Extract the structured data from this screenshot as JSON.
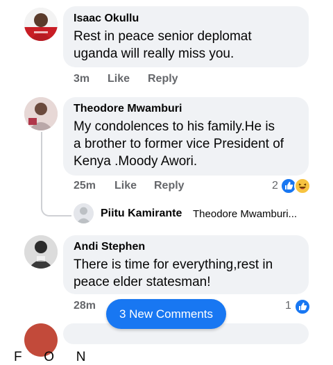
{
  "comments": [
    {
      "author": "Isaac Okullu",
      "text_lines": [
        "Rest in peace senior deplomat",
        "uganda will really miss you."
      ],
      "time": "3m",
      "like_label": "Like",
      "reply_label": "Reply"
    },
    {
      "author": "Theodore Mwamburi",
      "text_lines": [
        "My condolences to his family.He is",
        "a brother to former vice President of",
        "Kenya .Moody Awori."
      ],
      "time": "25m",
      "like_label": "Like",
      "reply_label": "Reply",
      "reaction_count": "2",
      "reactions": [
        "like-icon",
        "haha-icon"
      ],
      "reply_preview": {
        "author": "Piitu Kamirante",
        "text": "Theodore Mwamburi..."
      }
    },
    {
      "author": "Andi Stephen",
      "text_lines": [
        "There is time for everything,rest in",
        "peace elder statesman!"
      ],
      "time": "28m",
      "reaction_count": "1",
      "reactions": [
        "like-icon"
      ]
    }
  ],
  "new_comments_button": "3 New Comments",
  "bottom_partial_text": "F      O      N",
  "colors": {
    "bubble": "#f0f2f5",
    "accent": "#1877f2",
    "meta": "#65676b"
  }
}
